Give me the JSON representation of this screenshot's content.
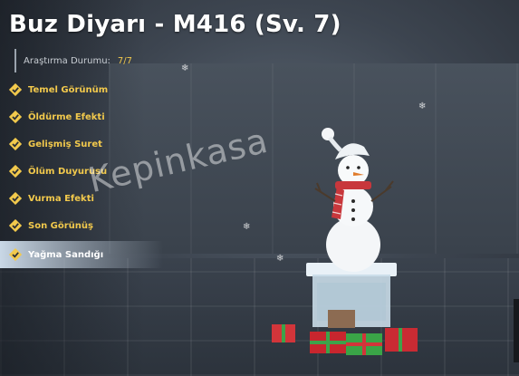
{
  "title": "Buz Diyarı - M416 (Sv. 7)",
  "research": {
    "label": "Araştırma Durumu:",
    "value": "7/7"
  },
  "menu": [
    {
      "label": "Temel Görünüm"
    },
    {
      "label": "Öldürme Efekti"
    },
    {
      "label": "Gelişmiş Suret"
    },
    {
      "label": "Ölüm Duyurusu"
    },
    {
      "label": "Vurma Efekti"
    },
    {
      "label": "Son Görünüş"
    },
    {
      "label": "Yağma Sandığı"
    }
  ],
  "active_index": 6,
  "watermark": "Kepinkasa",
  "colors": {
    "accent": "#f2c94c",
    "check_bg": "#f2c94c",
    "active_bg": "#d2e1f0"
  }
}
